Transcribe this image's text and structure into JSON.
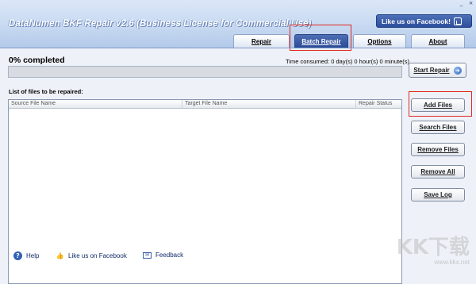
{
  "window": {
    "minimize_glyph": "_",
    "close_glyph": "×"
  },
  "app": {
    "title": "DataNumen BKF Repair v2.6 (Business License for Commercial Use)"
  },
  "facebook_button": {
    "label": "Like us on Facebook!",
    "icon": "facebook-like-icon"
  },
  "tabs": [
    {
      "label": "Repair",
      "active": false
    },
    {
      "label": "Batch Repair",
      "active": true
    },
    {
      "label": "Options",
      "active": false
    },
    {
      "label": "About",
      "active": false
    }
  ],
  "progress": {
    "percent_label": "0% completed",
    "time_consumed": "Time consumed:  0 day(s) 0 hour(s) 0 minute(s)",
    "value": 0
  },
  "file_list": {
    "label": "List of files to be repaired:",
    "columns": [
      "Source File Name",
      "Target File Name",
      "Repair Status"
    ],
    "rows": []
  },
  "buttons": {
    "start_repair": "Start Repair",
    "add_files": "Add Files",
    "search_files": "Search Files",
    "remove_files": "Remove Files",
    "remove_all": "Remove All",
    "save_log": "Save Log"
  },
  "footer": {
    "help": "Help",
    "like_facebook": "Like us on Facebook",
    "feedback": "Feedback"
  },
  "watermark": {
    "main": "KK下载",
    "sub": "www.kkx.net"
  },
  "colors": {
    "highlight": "#e0281e",
    "accent": "#2b4b96"
  }
}
